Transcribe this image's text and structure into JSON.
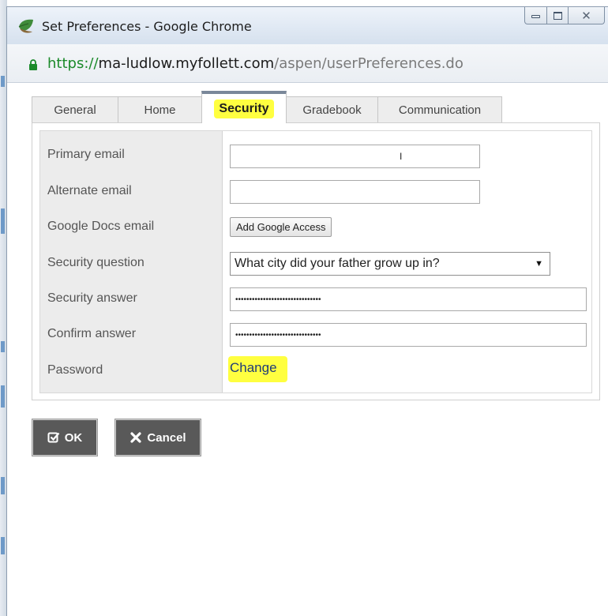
{
  "window": {
    "title": "Set Preferences - Google Chrome",
    "minimize_glyph": "",
    "close_glyph": "✕"
  },
  "address": {
    "scheme": "https://",
    "domain": "ma-ludlow.myfollett.com",
    "path": "/aspen/userPreferences.do"
  },
  "tabs": [
    {
      "label": "General",
      "active": false
    },
    {
      "label": "Home",
      "active": false
    },
    {
      "label": "Security",
      "active": true,
      "highlighted": true
    },
    {
      "label": "Gradebook",
      "active": false
    },
    {
      "label": "Communication",
      "active": false
    }
  ],
  "form": {
    "primary_email": {
      "label": "Primary email",
      "value": "I"
    },
    "alternate_email": {
      "label": "Alternate email",
      "value": ""
    },
    "google_docs": {
      "label": "Google Docs email",
      "button": "Add Google Access"
    },
    "security_question": {
      "label": "Security question",
      "value": "What city did your father grow up in?",
      "arrow": "▼"
    },
    "security_answer": {
      "label": "Security answer",
      "value": "•••••••••••••••••••••••••••••••"
    },
    "confirm_answer": {
      "label": "Confirm answer",
      "value": "•••••••••••••••••••••••••••••••"
    },
    "password": {
      "label": "Password",
      "link": "Change"
    }
  },
  "actions": {
    "ok": "OK",
    "cancel": "Cancel"
  },
  "colors": {
    "highlight": "#ffff40",
    "button_bg": "#595959",
    "secure_green": "#1b8a2a"
  }
}
